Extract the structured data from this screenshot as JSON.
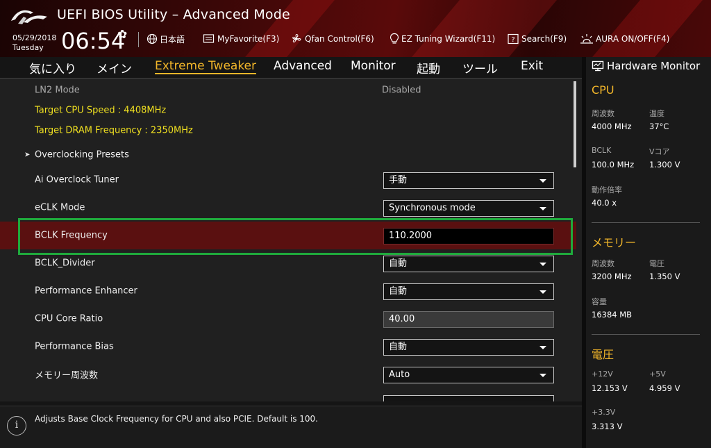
{
  "header": {
    "title": "UEFI BIOS Utility – Advanced Mode",
    "date": "05/29/2018",
    "weekday": "Tuesday",
    "time": "06:54",
    "items": [
      {
        "label": "日本語",
        "icon": "globe-icon"
      },
      {
        "label": "MyFavorite(F3)",
        "icon": "favorite-icon"
      },
      {
        "label": "Qfan Control(F6)",
        "icon": "fan-icon"
      },
      {
        "label": "EZ Tuning Wizard(F11)",
        "icon": "lightbulb-icon"
      },
      {
        "label": "Search(F9)",
        "icon": "question-icon"
      },
      {
        "label": "AURA ON/OFF(F4)",
        "icon": "aura-icon"
      }
    ]
  },
  "tabs": [
    {
      "label": "気に入り"
    },
    {
      "label": "メイン"
    },
    {
      "label": "Extreme Tweaker",
      "active": true
    },
    {
      "label": "Advanced"
    },
    {
      "label": "Monitor"
    },
    {
      "label": "起動"
    },
    {
      "label": "ツール"
    },
    {
      "label": "Exit"
    }
  ],
  "settings": {
    "ln2_label": "LN2 Mode",
    "ln2_value": "Disabled",
    "target_cpu": "Target CPU Speed : 4408MHz",
    "target_dram": "Target DRAM Frequency : 2350MHz",
    "oc_presets": "Overclocking Presets",
    "ai_oc_label": "Ai Overclock Tuner",
    "ai_oc_value": "手動",
    "eclk_label": "eCLK Mode",
    "eclk_value": "Synchronous mode",
    "bclk_label": "BCLK Frequency",
    "bclk_value": "110.2000",
    "bclk_div_label": "BCLK_Divider",
    "bclk_div_value": "自動",
    "perf_enh_label": "Performance Enhancer",
    "perf_enh_value": "自動",
    "cpu_ratio_label": "CPU Core Ratio",
    "cpu_ratio_value": "40.00",
    "perf_bias_label": "Performance Bias",
    "perf_bias_value": "自動",
    "mem_freq_label": "メモリー周波数",
    "mem_freq_value": "Auto"
  },
  "help": {
    "text": "Adjusts Base Clock Frequency for CPU and also PCIE. Default is 100."
  },
  "hw": {
    "title": "Hardware Monitor",
    "cpu": {
      "title": "CPU",
      "freq_label": "周波数",
      "freq_value": "4000 MHz",
      "temp_label": "温度",
      "temp_value": "37°C",
      "bclk_label": "BCLK",
      "bclk_value": "100.0 MHz",
      "vcore_label": "Vコア",
      "vcore_value": "1.300 V",
      "ratio_label": "動作倍率",
      "ratio_value": "40.0 x"
    },
    "memory": {
      "title": "メモリー",
      "freq_label": "周波数",
      "freq_value": "3200 MHz",
      "volt_label": "電圧",
      "volt_value": "1.350 V",
      "cap_label": "容量",
      "cap_value": "16384 MB"
    },
    "voltage": {
      "title": "電圧",
      "v12_label": "+12V",
      "v12_value": "12.153 V",
      "v5_label": "+5V",
      "v5_value": "4.959 V",
      "v33_label": "+3.3V",
      "v33_value": "3.313 V"
    }
  },
  "colors": {
    "accent": "#f2b62a",
    "highlight_border": "#1faa3c",
    "selected_row": "#5a1010",
    "target_text": "#f0e020"
  }
}
